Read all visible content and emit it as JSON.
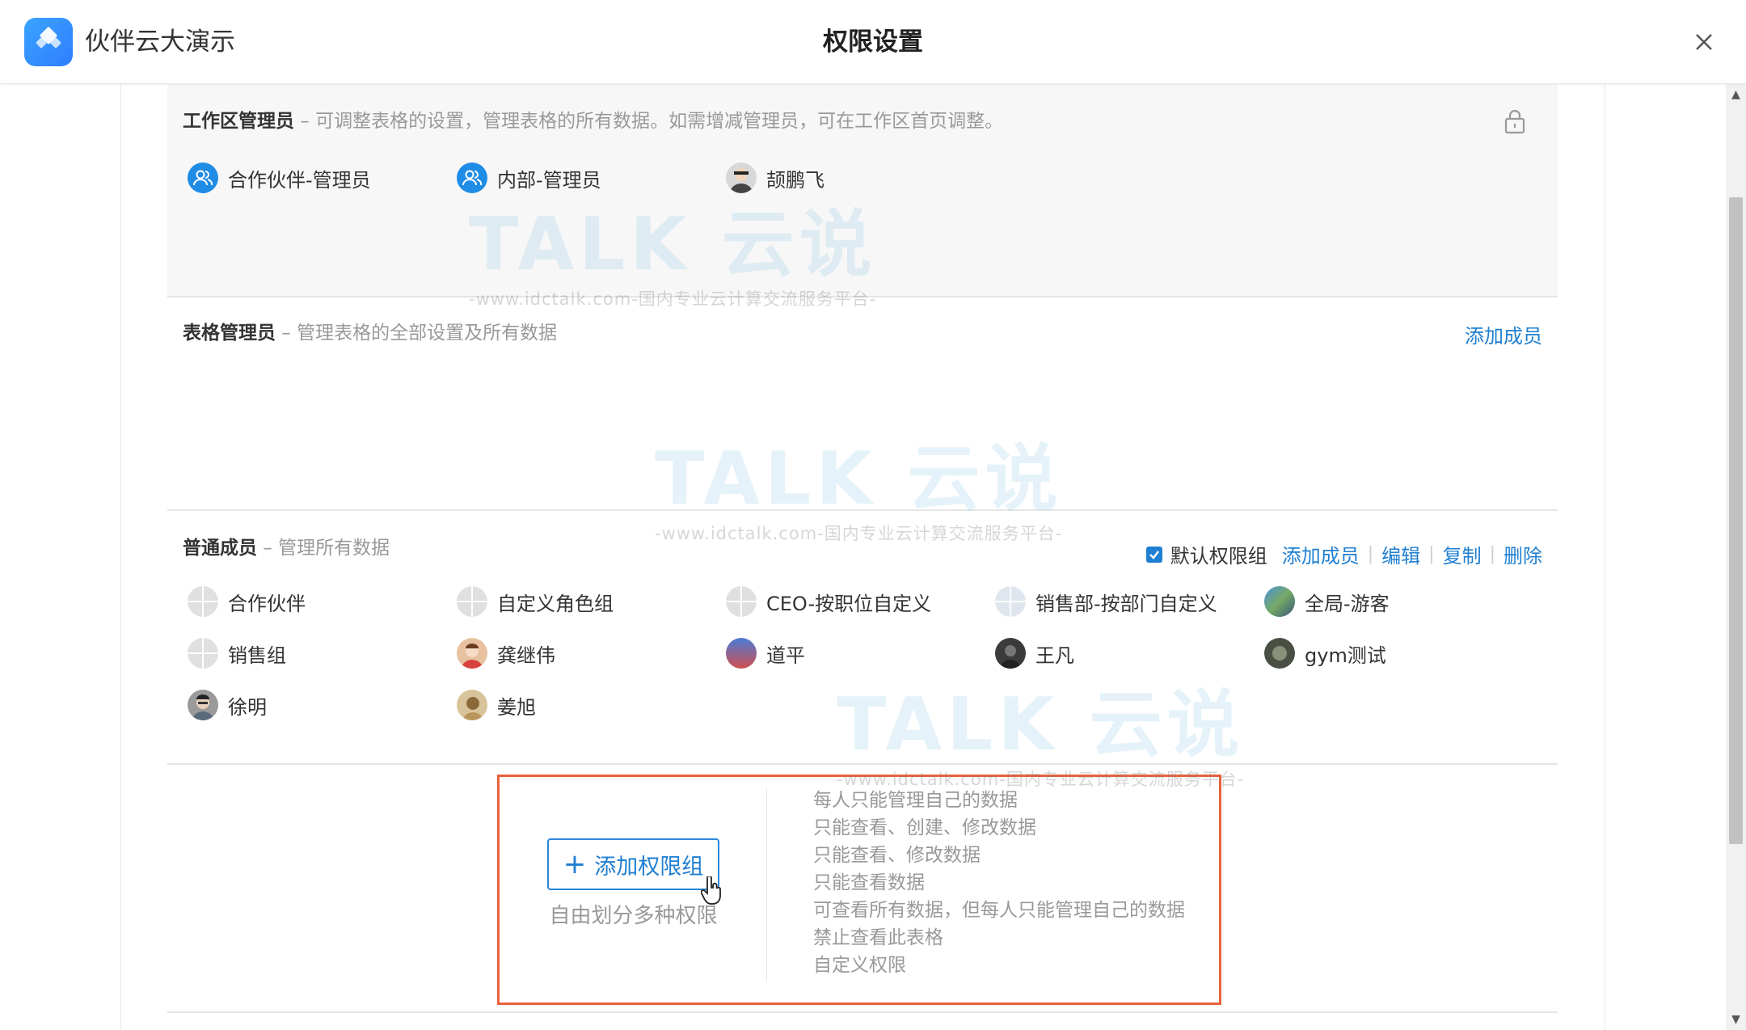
{
  "header": {
    "app_name": "伙伴云大演示",
    "page_title": "权限设置",
    "logo_text": "伙伴云大演示"
  },
  "watermark": {
    "logo": "TALK 云说",
    "url": "-www.idctalk.com-国内专业云计算交流服务平台-"
  },
  "sections": {
    "workspace_admin": {
      "title": "工作区管理员",
      "desc": " – 可调整表格的设置，管理表格的所有数据。如需增减管理员，可在工作区首页调整。",
      "members": [
        {
          "name": "合作伙伴-管理员",
          "avatar": "group-icon"
        },
        {
          "name": "内部-管理员",
          "avatar": "group-icon"
        },
        {
          "name": "颉鹏飞",
          "avatar": "user-photo"
        }
      ]
    },
    "table_admin": {
      "title": "表格管理员",
      "desc": " – 管理表格的全部设置及所有数据",
      "add_member": "添加成员"
    },
    "regular_member": {
      "title": "普通成员",
      "desc": " – 管理所有数据",
      "default_group_label": "默认权限组",
      "actions": {
        "add_member": "添加成员",
        "edit": "编辑",
        "copy": "复制",
        "delete": "删除"
      },
      "members": [
        {
          "name": "合作伙伴"
        },
        {
          "name": "自定义角色组"
        },
        {
          "name": "CEO-按职位自定义"
        },
        {
          "name": "销售部-按部门自定义"
        },
        {
          "name": "全局-游客"
        },
        {
          "name": "销售组"
        },
        {
          "name": "龚继伟"
        },
        {
          "name": "道平"
        },
        {
          "name": "王凡"
        },
        {
          "name": "gym测试"
        },
        {
          "name": "徐明"
        },
        {
          "name": "姜旭"
        }
      ]
    },
    "add_group": {
      "button_label": "添加权限组",
      "caption": "自由划分多种权限",
      "permissions": [
        "每人只能管理自己的数据",
        "只能查看、创建、修改数据",
        "只能查看、修改数据",
        "只能查看数据",
        "可查看所有数据，但每人只能管理自己的数据",
        "禁止查看此表格",
        "自定义权限"
      ]
    }
  },
  "colors": {
    "accent": "#1f7fd1",
    "highlight_border": "#e8623c",
    "admin_bg": "#f7f7f7"
  }
}
